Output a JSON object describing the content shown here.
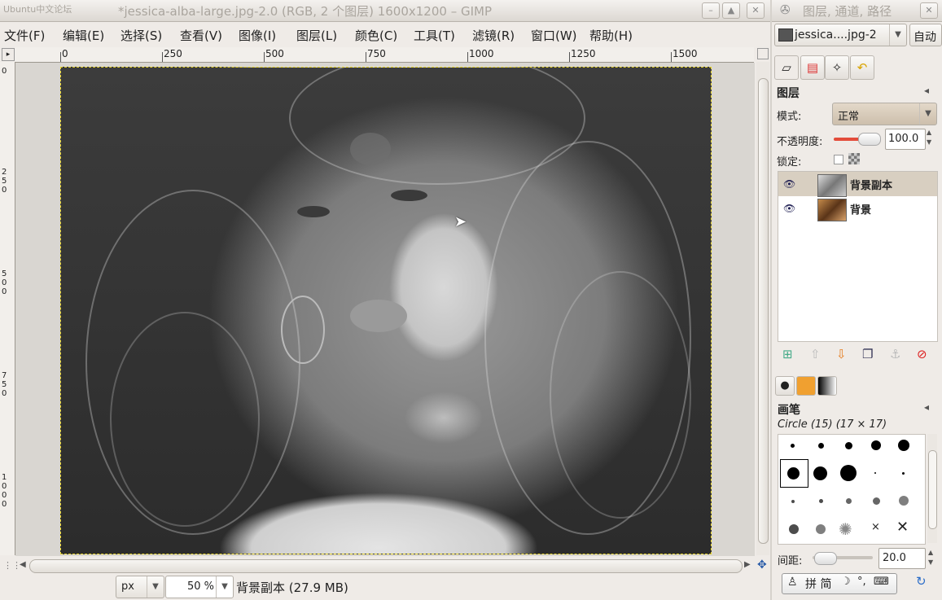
{
  "main_window": {
    "title": "*jessica-alba-large.jpg-2.0 (RGB, 2 个图层) 1600x1200 – GIMP",
    "background_tab": "Ubuntu中文论坛"
  },
  "menu": [
    "文件(F)",
    "编辑(E)",
    "选择(S)",
    "查看(V)",
    "图像(I)",
    "图层(L)",
    "颜色(C)",
    "工具(T)",
    "滤镜(R)",
    "窗口(W)",
    "帮助(H)"
  ],
  "ruler": {
    "h_labels": [
      "0",
      "250",
      "500",
      "750",
      "1000",
      "1250",
      "1500"
    ],
    "v_labels": [
      "0",
      "250",
      "500",
      "750",
      "1000"
    ]
  },
  "status": {
    "unit": "px",
    "zoom": "50 %",
    "info": "背景副本 (27.9 MB)"
  },
  "dock": {
    "title": "图层, 通道, 路径",
    "image_selector": "jessica....jpg-2",
    "auto_button": "自动",
    "layers_panel": {
      "title": "图层",
      "mode_label": "模式:",
      "mode_value": "正常",
      "opacity_label": "不透明度:",
      "opacity_value": "100.0",
      "opacity_level": 1.0,
      "lock_label": "锁定:",
      "layers": [
        {
          "name": "背景副本",
          "selected": true,
          "visible": true
        },
        {
          "name": "背景",
          "selected": false,
          "visible": true
        }
      ]
    },
    "brushes_panel": {
      "title": "画笔",
      "brush_name": "Circle (15) (17 × 17)",
      "spacing_label": "间距:",
      "spacing_value": "20.0"
    },
    "ime": {
      "label": "拼 简"
    }
  },
  "colors": {
    "selection_border": "#e8d52a",
    "selected_layer_bg": "#d8cfc1",
    "window_bg": "#efebe7"
  }
}
